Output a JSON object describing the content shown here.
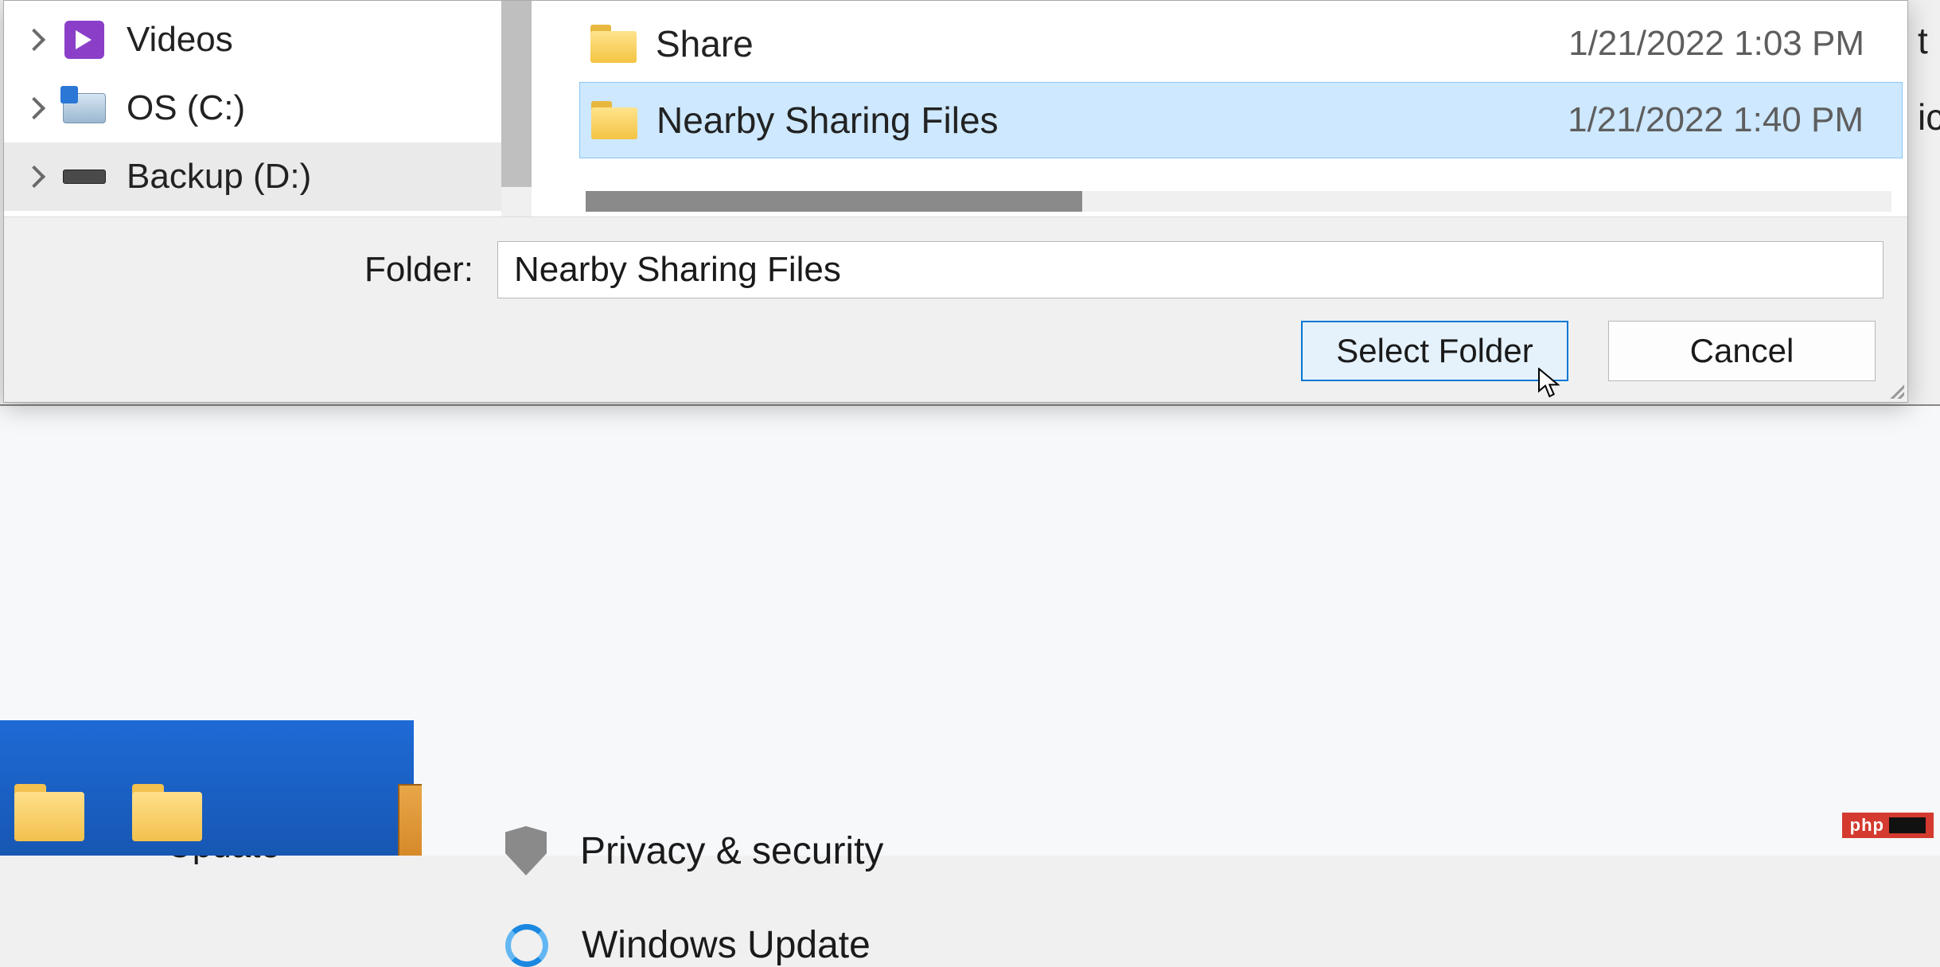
{
  "nav": {
    "items": [
      {
        "label": "Videos"
      },
      {
        "label": "OS (C:)"
      },
      {
        "label": "Backup (D:)"
      }
    ]
  },
  "files": {
    "rows": [
      {
        "name": "Share",
        "date": "1/21/2022 1:03 PM"
      },
      {
        "name": "Nearby Sharing Files",
        "date": "1/21/2022 1:40 PM"
      }
    ]
  },
  "bottom": {
    "folder_label": "Folder:",
    "folder_value": "Nearby Sharing Files",
    "select_label": "Select Folder",
    "cancel_label": "Cancel"
  },
  "settings": {
    "sidebar_label": "Update",
    "items": [
      {
        "label": "Privacy & security"
      },
      {
        "label": "Windows Update"
      }
    ]
  },
  "edge": {
    "a": "t",
    "b": "ic"
  },
  "watermark": {
    "text": "php"
  }
}
